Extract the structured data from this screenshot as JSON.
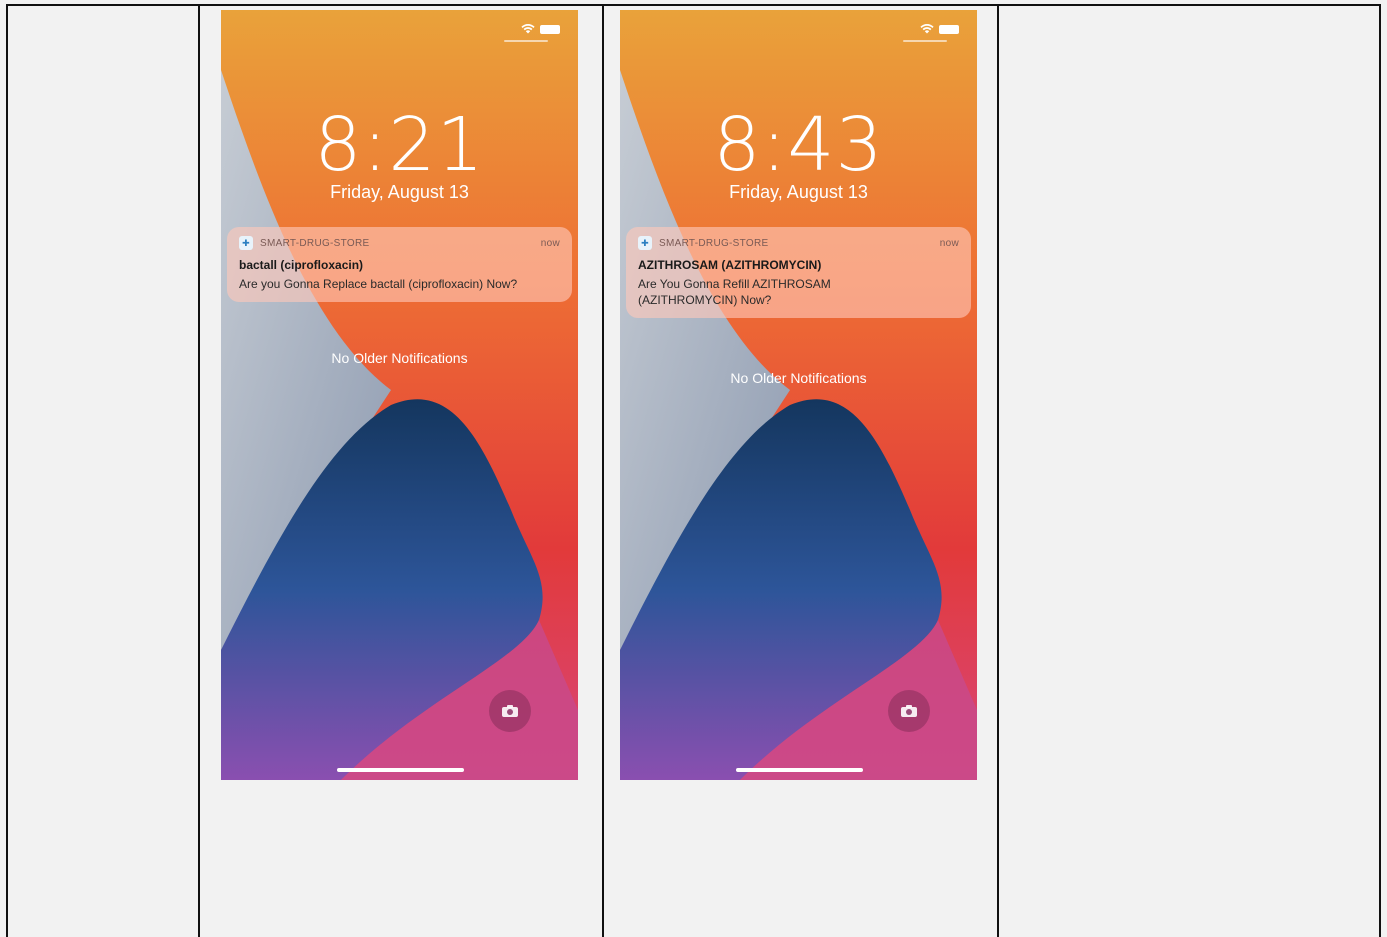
{
  "phones": [
    {
      "time": "8:21",
      "date": "Friday, August 13",
      "notification": {
        "app": "SMART-DRUG-STORE",
        "time": "now",
        "title": "bactall (ciprofloxacin)",
        "body": "Are you Gonna Replace bactall (ciprofloxacin)  Now?"
      },
      "older": "No Older Notifications"
    },
    {
      "time": "8:43",
      "date": "Friday, August 13",
      "notification": {
        "app": "SMART-DRUG-STORE",
        "time": "now",
        "title": "AZITHROSAM (AZITHROMYCIN)",
        "body": "Are You Gonna Refill AZITHROSAM (AZITHROMYCIN) Now?"
      },
      "older": "No Older Notifications"
    }
  ],
  "icons": [
    "wifi-icon",
    "battery-icon",
    "app-icon",
    "camera-icon"
  ]
}
